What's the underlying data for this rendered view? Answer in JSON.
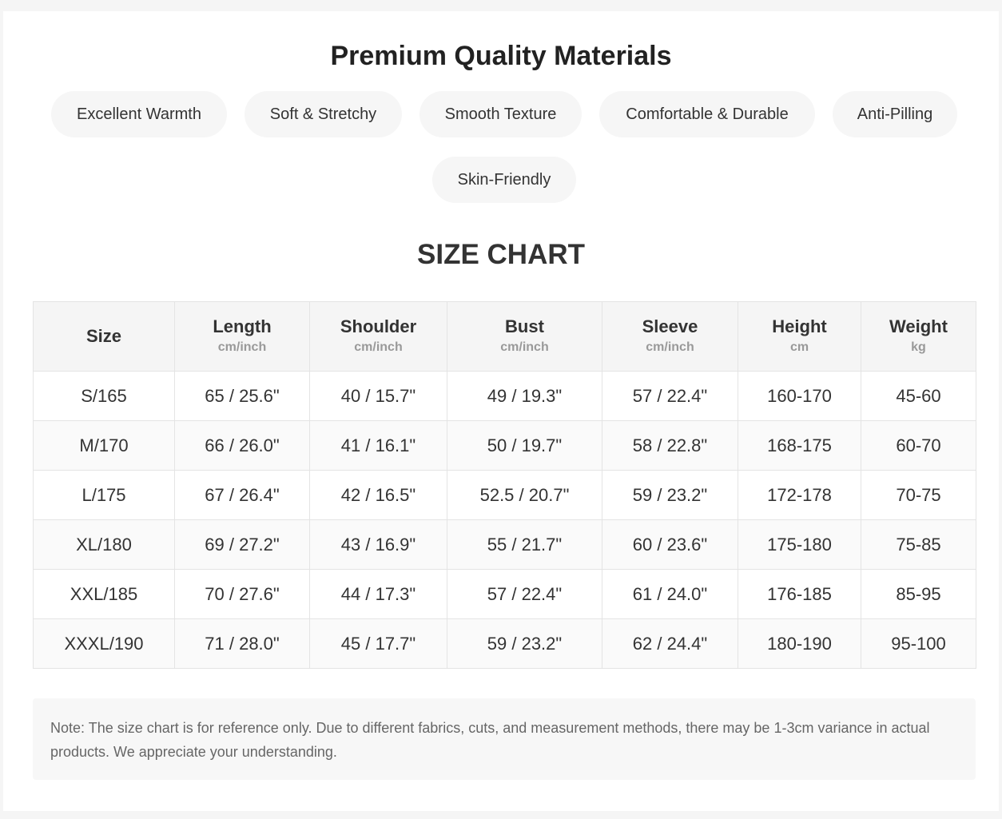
{
  "materials": {
    "title": "Premium Quality Materials",
    "chips": [
      "Excellent Warmth",
      "Soft & Stretchy",
      "Smooth Texture",
      "Comfortable & Durable",
      "Anti-Pilling",
      "Skin-Friendly"
    ]
  },
  "size_chart": {
    "title": "SIZE CHART",
    "headers": [
      {
        "label": "Size",
        "unit": ""
      },
      {
        "label": "Length",
        "unit": "cm/inch"
      },
      {
        "label": "Shoulder",
        "unit": "cm/inch"
      },
      {
        "label": "Bust",
        "unit": "cm/inch"
      },
      {
        "label": "Sleeve",
        "unit": "cm/inch"
      },
      {
        "label": "Height",
        "unit": "cm"
      },
      {
        "label": "Weight",
        "unit": "kg"
      }
    ],
    "rows": [
      [
        "S/165",
        "65 / 25.6\"",
        "40 / 15.7\"",
        "49 / 19.3\"",
        "57 / 22.4\"",
        "160-170",
        "45-60"
      ],
      [
        "M/170",
        "66 / 26.0\"",
        "41 / 16.1\"",
        "50 / 19.7\"",
        "58 / 22.8\"",
        "168-175",
        "60-70"
      ],
      [
        "L/175",
        "67 / 26.4\"",
        "42 / 16.5\"",
        "52.5 / 20.7\"",
        "59 / 23.2\"",
        "172-178",
        "70-75"
      ],
      [
        "XL/180",
        "69 / 27.2\"",
        "43 / 16.9\"",
        "55 / 21.7\"",
        "60 / 23.6\"",
        "175-180",
        "75-85"
      ],
      [
        "XXL/185",
        "70 / 27.6\"",
        "44 / 17.3\"",
        "57 / 22.4\"",
        "61 / 24.0\"",
        "176-185",
        "85-95"
      ],
      [
        "XXXL/190",
        "71 / 28.0\"",
        "45 / 17.7\"",
        "59 / 23.2\"",
        "62 / 24.4\"",
        "180-190",
        "95-100"
      ]
    ]
  },
  "note": {
    "text": "Note: The size chart is for reference only. Due to different fabrics, cuts, and measurement methods, there may be 1-3cm variance in actual products. We appreciate your understanding."
  }
}
